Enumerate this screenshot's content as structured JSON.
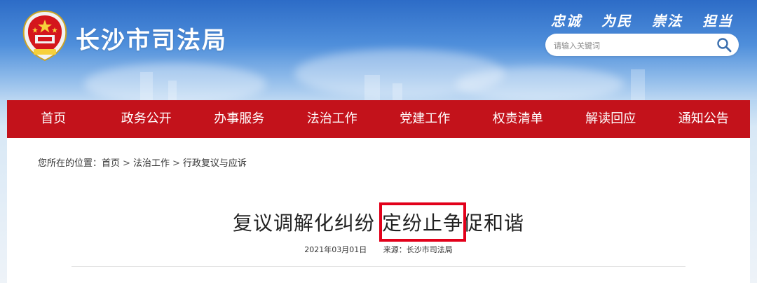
{
  "header": {
    "site_title": "长沙市司法局",
    "slogans": [
      "忠诚",
      "为民",
      "崇法",
      "担当"
    ],
    "search": {
      "placeholder": "请输入关键词"
    }
  },
  "nav": {
    "items": [
      "首页",
      "政务公开",
      "办事服务",
      "法治工作",
      "党建工作",
      "权责清单",
      "解读回应",
      "通知公告"
    ]
  },
  "breadcrumb": {
    "prefix": "您所在的位置：",
    "items": [
      "首页",
      "法治工作",
      "行政复议与应诉"
    ],
    "separator": ">"
  },
  "article": {
    "title_part1": "复议调解化纠纷 ",
    "title_highlight": "定纷止争",
    "title_part2": "促和谐",
    "date": "2021年03月01日",
    "source": "来源：长沙市司法局"
  },
  "colors": {
    "nav_bg": "#c3121b",
    "highlight_border": "#e2001a"
  }
}
